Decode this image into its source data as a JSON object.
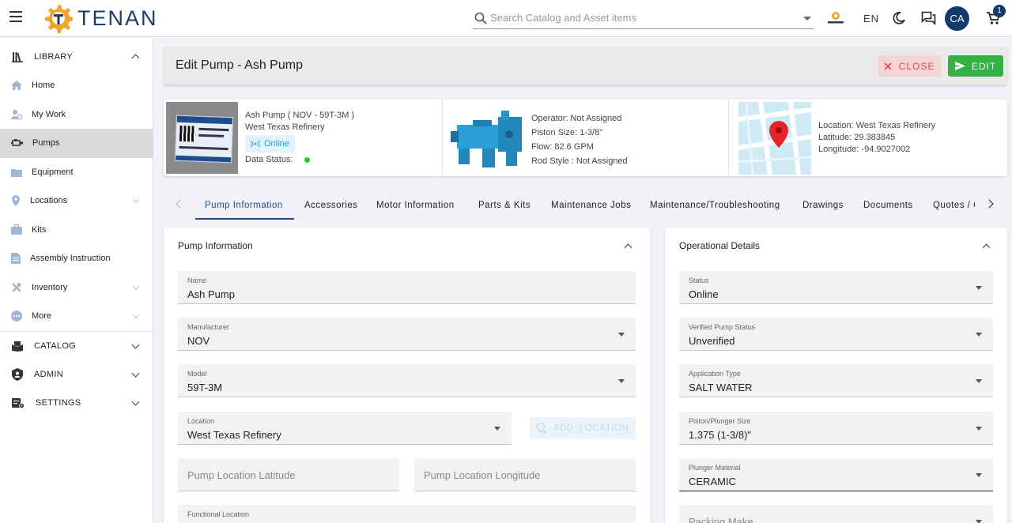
{
  "app": {
    "logo_text": "TENAN"
  },
  "topbar": {
    "search_placeholder": "Search Catalog and Asset items",
    "language": "EN",
    "avatar_initials": "CA",
    "cart_count": "1"
  },
  "sidebar": {
    "library_label": "LIBRARY",
    "items": [
      {
        "label": "Home"
      },
      {
        "label": "My Work"
      },
      {
        "label": "Pumps"
      },
      {
        "label": "Equipment"
      },
      {
        "label": "Locations"
      },
      {
        "label": "Kits"
      },
      {
        "label": "Assembly Instruction"
      },
      {
        "label": "Inventory"
      },
      {
        "label": "More"
      }
    ],
    "catalog_label": "CATALOG",
    "admin_label": "ADMIN",
    "settings_label": "SETTINGS"
  },
  "header": {
    "title": "Edit Pump - Ash Pump",
    "close_label": "CLOSE",
    "edit_label": "EDIT"
  },
  "summary": {
    "asset_name": "Ash Pump ( NOV - 59T-3M )",
    "asset_location": "West Texas Refinery",
    "online_label": "Online",
    "data_status_label": "Data Status:",
    "operator": "Operator: Not Assigned",
    "piston_size": "Piston Size: 1-3/8\"",
    "flow": "Flow: 82.6 GPM",
    "rod_style": "Rod Style : Not Assigned",
    "location": "Location: West Texas Refinery",
    "latitude": "Latitude: 29.383845",
    "longitude": "Longitude: -94.9027002"
  },
  "tabs": [
    {
      "label": "Pump Information"
    },
    {
      "label": "Accessories"
    },
    {
      "label": "Motor Information"
    },
    {
      "label": "Parts & Kits"
    },
    {
      "label": "Maintenance Jobs"
    },
    {
      "label": "Maintenance/Troubleshooting"
    },
    {
      "label": "Drawings"
    },
    {
      "label": "Documents"
    },
    {
      "label": "Quotes / Orders"
    }
  ],
  "pump_info": {
    "title": "Pump Information",
    "name": {
      "label": "Name",
      "value": "Ash Pump"
    },
    "manufacturer": {
      "label": "Manufacturer",
      "value": "NOV"
    },
    "model": {
      "label": "Model",
      "value": "59T-3M"
    },
    "location": {
      "label": "Location",
      "value": "West Texas Refinery"
    },
    "add_location_label": "ADD_LOCATION",
    "latitude_placeholder": "Pump Location Latitude",
    "longitude_placeholder": "Pump Location Longitude",
    "functional_location": {
      "label": "Functional Location",
      "value": ""
    }
  },
  "operational": {
    "title": "Operational Details",
    "status": {
      "label": "Status",
      "value": "Online"
    },
    "verified": {
      "label": "Verified Pump Status",
      "value": "Unverified"
    },
    "application": {
      "label": "Application Type",
      "value": "SALT WATER"
    },
    "piston": {
      "label": "Piston/Plunger Size",
      "value": "1.375 (1-3/8)\""
    },
    "plunger": {
      "label": "Plunger Material",
      "value": "CERAMIC"
    },
    "packing_make_placeholder": "Packing Make"
  },
  "colors": {
    "brand": "#1d3c66",
    "accent": "#1d4c8f",
    "edit_green": "#34b046",
    "close_red": "#e04848",
    "online_blue": "#1aa3d8",
    "status_green": "#13d813"
  }
}
